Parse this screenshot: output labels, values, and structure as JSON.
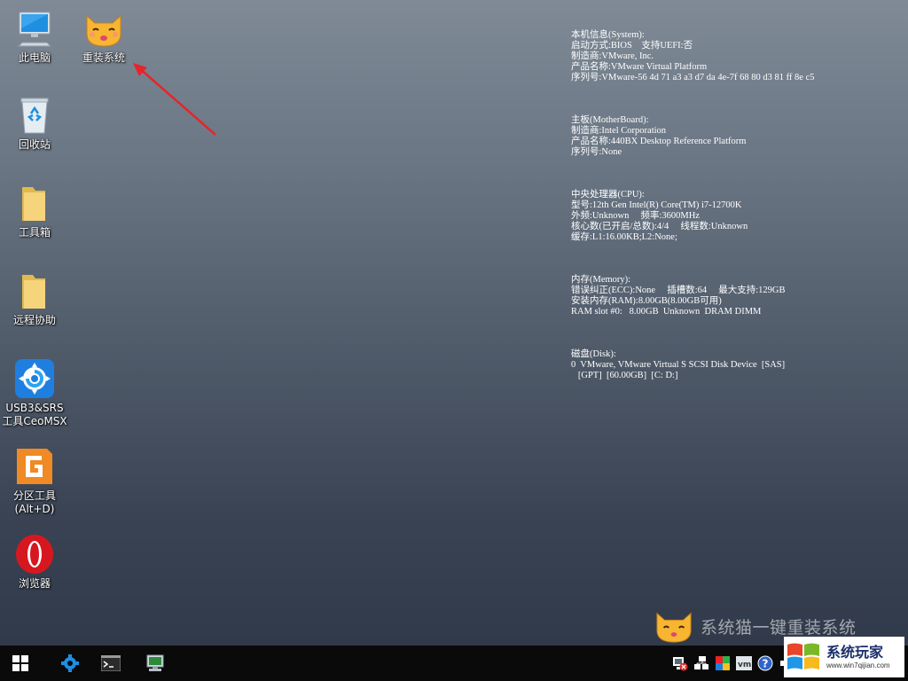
{
  "desktop": {
    "icons": [
      {
        "label": "此电脑",
        "icon": "computer-icon"
      },
      {
        "label": "重装系统",
        "icon": "cat-reinstall-icon"
      },
      {
        "label": "回收站",
        "icon": "recycle-bin-icon"
      },
      {
        "label": "工具箱",
        "icon": "folder-icon"
      },
      {
        "label": "远程协助",
        "icon": "folder-icon"
      },
      {
        "label": "USB3&SRS\n工具CeoMSX",
        "icon": "usb-tool-icon"
      },
      {
        "label": "分区工具\n(Alt+D)",
        "icon": "diskgenius-icon"
      },
      {
        "label": "浏览器",
        "icon": "opera-browser-icon"
      }
    ]
  },
  "sysinfo": {
    "system": [
      "本机信息(System):",
      "启动方式:BIOS    支持UEFI:否",
      "制造商:VMware, Inc.",
      "产品名称:VMware Virtual Platform",
      "序列号:VMware-56 4d 71 a3 a3 d7 da 4e-7f 68 80 d3 81 ff 8e c5"
    ],
    "motherboard": [
      "主板(MotherBoard):",
      "制造商:Intel Corporation",
      "产品名称:440BX Desktop Reference Platform",
      "序列号:None"
    ],
    "cpu": [
      "中央处理器(CPU):",
      "型号:12th Gen Intel(R) Core(TM) i7-12700K",
      "外频:Unknown     频率:3600MHz",
      "核心数(已开启/总数):4/4     线程数:Unknown",
      "缓存:L1:16.00KB;L2:None;"
    ],
    "memory": [
      "内存(Memory):",
      "错误纠正(ECC):None     插槽数:64     最大支持:129GB",
      "安装内存(RAM):8.00GB(8.00GB可用)",
      "RAM slot #0:   8.00GB  Unknown  DRAM DIMM"
    ],
    "disk": [
      "磁盘(Disk):",
      "0  VMware, VMware Virtual S SCSI Disk Device  [SAS]",
      "   [GPT]  [60.00GB]  [C: D:]"
    ]
  },
  "watermark": {
    "text": "系统猫一键重装系统",
    "icon": "cat-logo-icon"
  },
  "taskbar": {
    "buttons": [
      {
        "icon": "windows-start-icon"
      },
      {
        "icon": "gear-tool-icon"
      },
      {
        "icon": "command-prompt-icon"
      },
      {
        "icon": "device-manager-icon"
      }
    ],
    "tray": [
      {
        "icon": "network-error-icon"
      },
      {
        "icon": "network-icon"
      },
      {
        "icon": "color-app-icon"
      },
      {
        "icon": "vmware-tools-icon"
      },
      {
        "icon": "help-icon"
      },
      {
        "icon": "volume-icon"
      }
    ]
  },
  "brand": {
    "name": "系统玩家",
    "url": "www.win7qijian.com"
  },
  "colors": {
    "arrow": "#e8232b",
    "desktop_top": "#7f8a96",
    "desktop_bottom": "#313a4a",
    "taskbar": "#0a0a0a"
  }
}
